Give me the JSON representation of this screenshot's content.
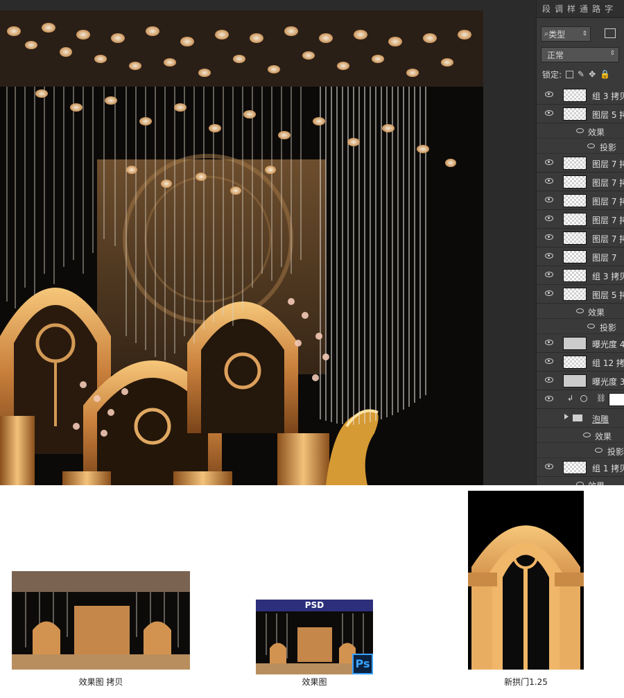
{
  "layers_panel": {
    "tabs": [
      "段",
      "调",
      "样",
      "通",
      "路",
      "字"
    ],
    "filter_label": "类型",
    "blend_mode": "正常",
    "lock_label": "锁定:",
    "layers": [
      {
        "label": "组 3 拷贝"
      },
      {
        "label": "图层 5 拷"
      },
      {
        "label": "效果",
        "type": "effect"
      },
      {
        "label": "投影",
        "type": "effect-item"
      },
      {
        "label": "图层 7 拷"
      },
      {
        "label": "图层 7 拷"
      },
      {
        "label": "图层 7 拷"
      },
      {
        "label": "图层 7 拷"
      },
      {
        "label": "图层 7 拷"
      },
      {
        "label": "图层 7"
      },
      {
        "label": "组 3 拷贝"
      },
      {
        "label": "图层 5 拷"
      },
      {
        "label": "效果",
        "type": "effect"
      },
      {
        "label": "投影",
        "type": "effect-item"
      },
      {
        "label": "曝光度 4"
      },
      {
        "label": "组 12 拷"
      },
      {
        "label": "曝光度 3"
      },
      {
        "label": "",
        "type": "adjustment"
      },
      {
        "label": "泡雕",
        "type": "group"
      },
      {
        "label": "效果",
        "type": "effect"
      },
      {
        "label": "投影",
        "type": "effect-item"
      },
      {
        "label": "组 1 拷贝"
      },
      {
        "label": "效果",
        "type": "effect"
      }
    ]
  },
  "files": [
    {
      "caption": "效果图 拷贝"
    },
    {
      "caption": "效果图",
      "banner": "PSD",
      "badge": "Ps"
    },
    {
      "caption": "新拱门1.25"
    }
  ]
}
